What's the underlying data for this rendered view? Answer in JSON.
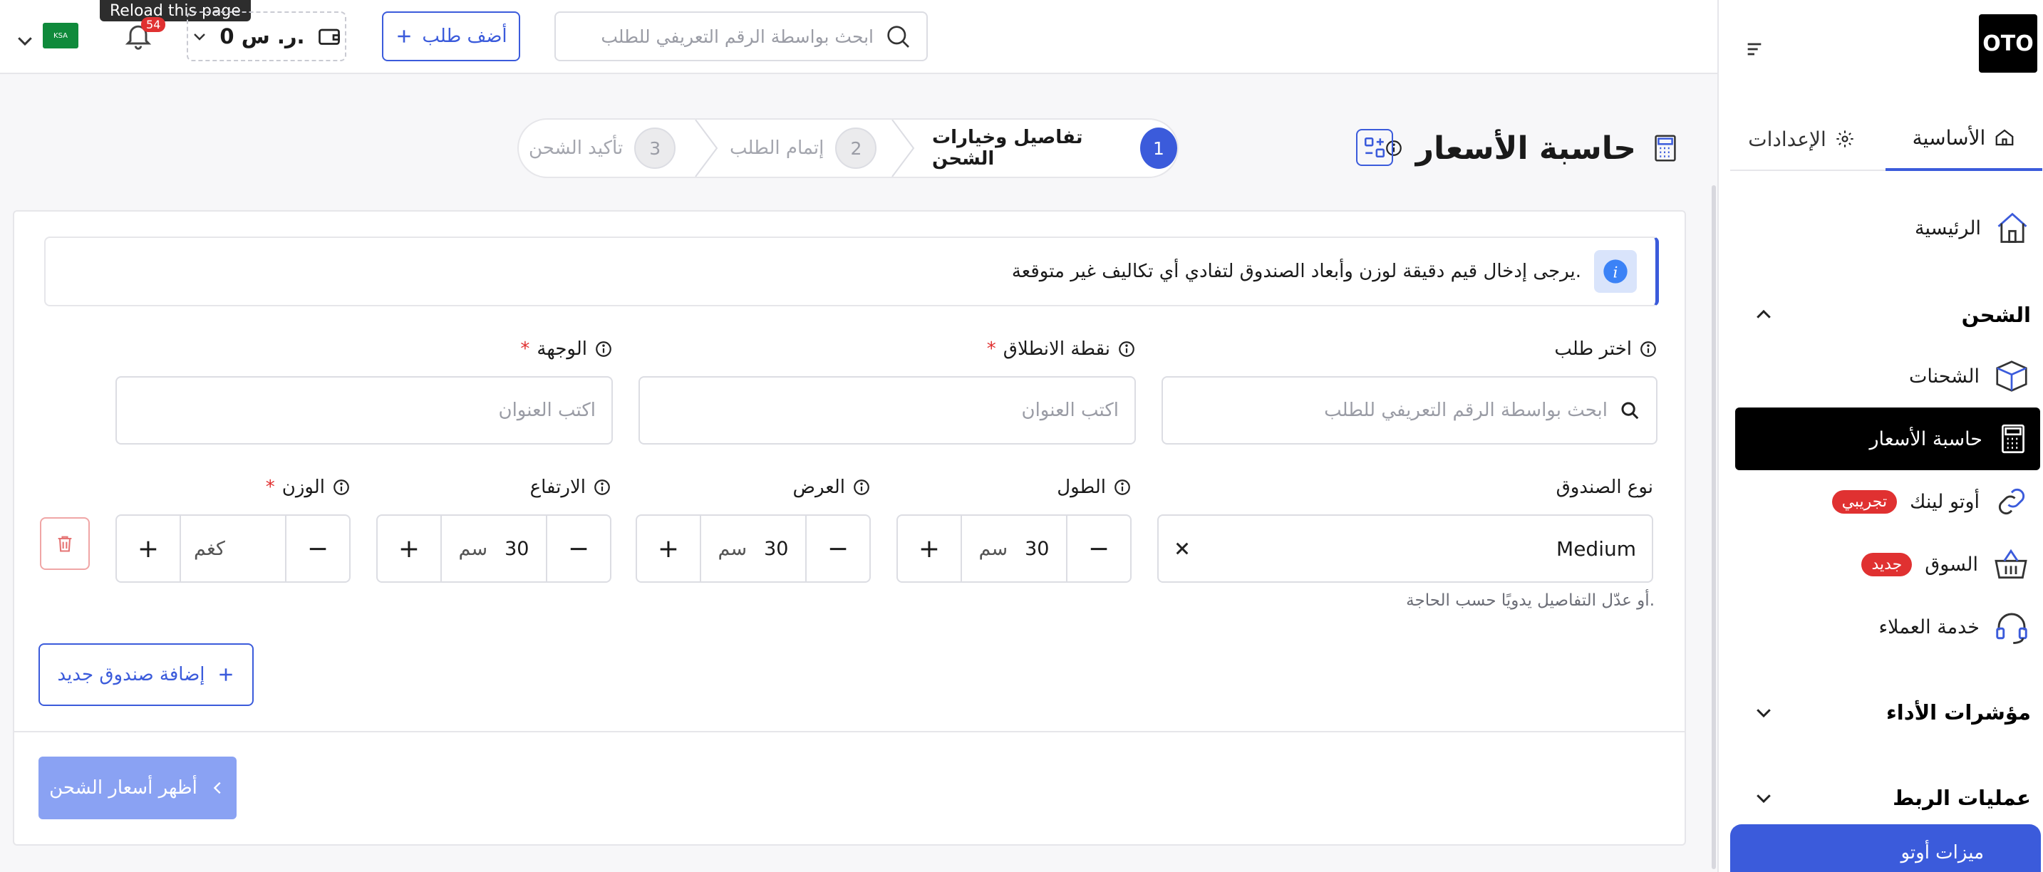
{
  "sidebar": {
    "logo": "OTO",
    "tabs": [
      {
        "label": "الأساسية",
        "icon": "home-icon",
        "active": true
      },
      {
        "label": "الإعدادات",
        "icon": "gear-icon",
        "active": false
      }
    ],
    "home": "الرئيسية",
    "shipping_section": "الشحن",
    "items": [
      {
        "label": "الشحنات",
        "icon": "box-icon"
      },
      {
        "label": "حاسبة الأسعار",
        "icon": "calculator-icon",
        "active": true
      },
      {
        "label": "أوتو لينك",
        "badge": "تجريبي",
        "icon": "link-icon"
      },
      {
        "label": "السوق",
        "badge": "جديد",
        "icon": "basket-icon"
      },
      {
        "label": "خدمة العملاء",
        "icon": "headset-icon"
      }
    ],
    "kpi_section": "مؤشرات الأداء",
    "integrations_section": "عمليات الربط",
    "features": "ميزات أوتو"
  },
  "topbar": {
    "search_placeholder": "ابحث بواسطة الرقم التعريفي للطلب",
    "add_order": "أضف طلب",
    "wallet": "0 ر. س.",
    "notifications_count": "54",
    "tooltip": "Reload this page",
    "flag_text": "KSA"
  },
  "page": {
    "title": "حاسبة الأسعار",
    "steps": [
      {
        "num": "1",
        "label": "تفاصيل وخيارات الشحن",
        "active": true
      },
      {
        "num": "2",
        "label": "إتمام الطلب",
        "active": false
      },
      {
        "num": "3",
        "label": "تأكيد الشحن",
        "active": false
      }
    ]
  },
  "form": {
    "notice": "يرجى إدخال قيم دقيقة لوزن وأبعاد الصندوق لتفادي أي تكاليف غير متوقعة.",
    "select_order_label": "اختر طلب",
    "select_order_placeholder": "ابحث بواسطة الرقم التعريفي للطلب",
    "origin_label": "نقطة الانطلاق",
    "origin_placeholder": "اكتب العنوان",
    "destination_label": "الوجهة",
    "destination_placeholder": "اكتب العنوان",
    "required_mark": "*",
    "box_type_label": "نوع الصندوق",
    "box_type_value": "Medium",
    "length_label": "الطول",
    "width_label": "العرض",
    "height_label": "الارتفاع",
    "weight_label": "الوزن",
    "length_value": "30",
    "width_value": "30",
    "height_value": "30",
    "weight_placeholder": "كغم",
    "unit_cm": "سم",
    "hint": "أو عدّل التفاصيل يدويًا حسب الحاجة.",
    "add_box": "إضافة صندوق جديد",
    "show_prices": "أظهر أسعار الشحن"
  },
  "colors": {
    "accent": "#3b5bdb",
    "danger": "#e03131",
    "muted_button": "#8aa2f3"
  }
}
